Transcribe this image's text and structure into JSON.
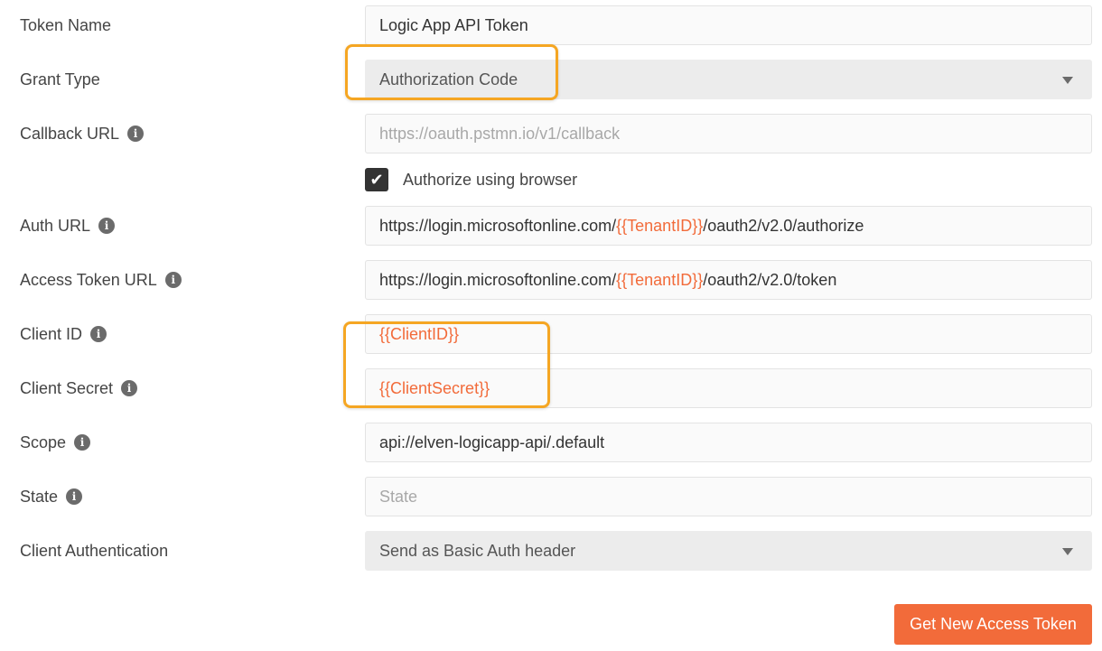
{
  "fields": {
    "token_name": {
      "label": "Token Name",
      "value": "Logic App API Token"
    },
    "grant_type": {
      "label": "Grant Type",
      "value": "Authorization Code"
    },
    "callback_url": {
      "label": "Callback URL",
      "placeholder": "https://oauth.pstmn.io/v1/callback"
    },
    "authorize_browser": {
      "label": "Authorize using browser",
      "checked": true
    },
    "auth_url": {
      "label": "Auth URL",
      "prefix": "https://login.microsoftonline.com/",
      "variable": "{{TenantID}}",
      "suffix": "/oauth2/v2.0/authorize"
    },
    "access_token_url": {
      "label": "Access Token URL",
      "prefix": "https://login.microsoftonline.com/",
      "variable": "{{TenantID}}",
      "suffix": "/oauth2/v2.0/token"
    },
    "client_id": {
      "label": "Client ID",
      "value": "{{ClientID}}"
    },
    "client_secret": {
      "label": "Client Secret",
      "value": "{{ClientSecret}}"
    },
    "scope": {
      "label": "Scope",
      "value": "api://elven-logicapp-api/.default"
    },
    "state": {
      "label": "State",
      "placeholder": "State"
    },
    "client_auth": {
      "label": "Client Authentication",
      "value": "Send as Basic Auth header"
    }
  },
  "actions": {
    "get_token_label": "Get New Access Token"
  },
  "icons": {
    "info": "info-icon",
    "caret": "chevron-down-icon",
    "check": "checkmark-icon"
  },
  "colors": {
    "accent": "#f26b3a",
    "highlight": "#f5a623",
    "variable": "#f26b3a"
  }
}
